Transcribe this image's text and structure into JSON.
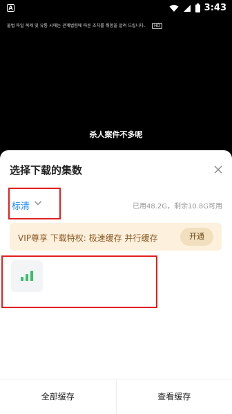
{
  "status_bar": {
    "app_icon_letter": "A",
    "time": "3:43"
  },
  "video": {
    "notice": "불법 파일 복제 및 유통 시에는 관계법령에 따른 조치를 취함을 알려 드립니다.",
    "hd_badge": "HD",
    "subtitle": "杀人案件不多呢"
  },
  "sheet": {
    "title": "选择下载的集数",
    "quality": {
      "label": "标清"
    },
    "storage_info": "已用48.2G，剩余10.8G可用",
    "vip_banner": {
      "text": "VIP尊享 下载特权: 极速缓存 并行缓存",
      "button_label": "开通"
    },
    "accent_color": "#1a8cff",
    "signal_color": "#3dbd6c",
    "bottom_bar": {
      "cache_all_label": "全部缓存",
      "view_cache_label": "查看缓存"
    }
  }
}
